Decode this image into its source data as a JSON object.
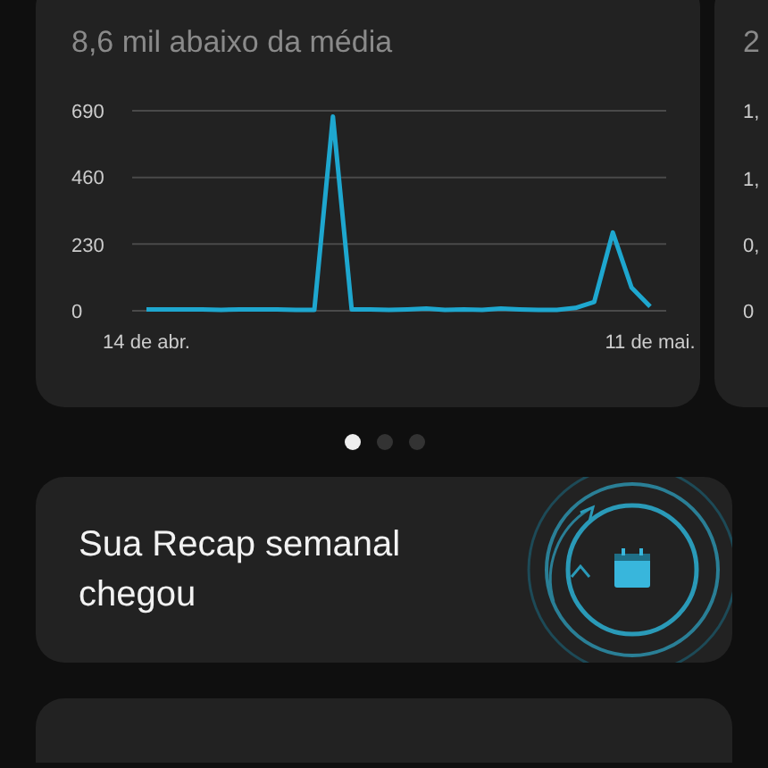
{
  "steps_card": {
    "subtitle": "8,6 mil abaixo da média",
    "chart_data": {
      "type": "line",
      "categories": [
        "14 de abr.",
        null,
        null,
        null,
        null,
        null,
        null,
        null,
        null,
        null,
        null,
        null,
        null,
        null,
        null,
        null,
        null,
        null,
        null,
        null,
        null,
        null,
        null,
        null,
        null,
        null,
        null,
        "11 de mai."
      ],
      "series": [
        {
          "color": "#1ea7cf",
          "values": [
            5,
            5,
            5,
            5,
            3,
            5,
            5,
            5,
            3,
            3,
            670,
            5,
            5,
            3,
            5,
            8,
            3,
            5,
            3,
            8,
            5,
            3,
            3,
            10,
            30,
            270,
            80,
            15
          ]
        }
      ],
      "ylim": [
        0,
        690
      ],
      "yticks": [
        0,
        230,
        460,
        690
      ]
    }
  },
  "next_card": {
    "subtitle": "2",
    "ticks": [
      "1,",
      "1,",
      "0,",
      "0"
    ]
  },
  "pager": [
    {
      "selected": true
    },
    {
      "selected": false
    },
    {
      "selected": false
    }
  ],
  "recap": {
    "title": "Sua Recap semanal chegou"
  }
}
